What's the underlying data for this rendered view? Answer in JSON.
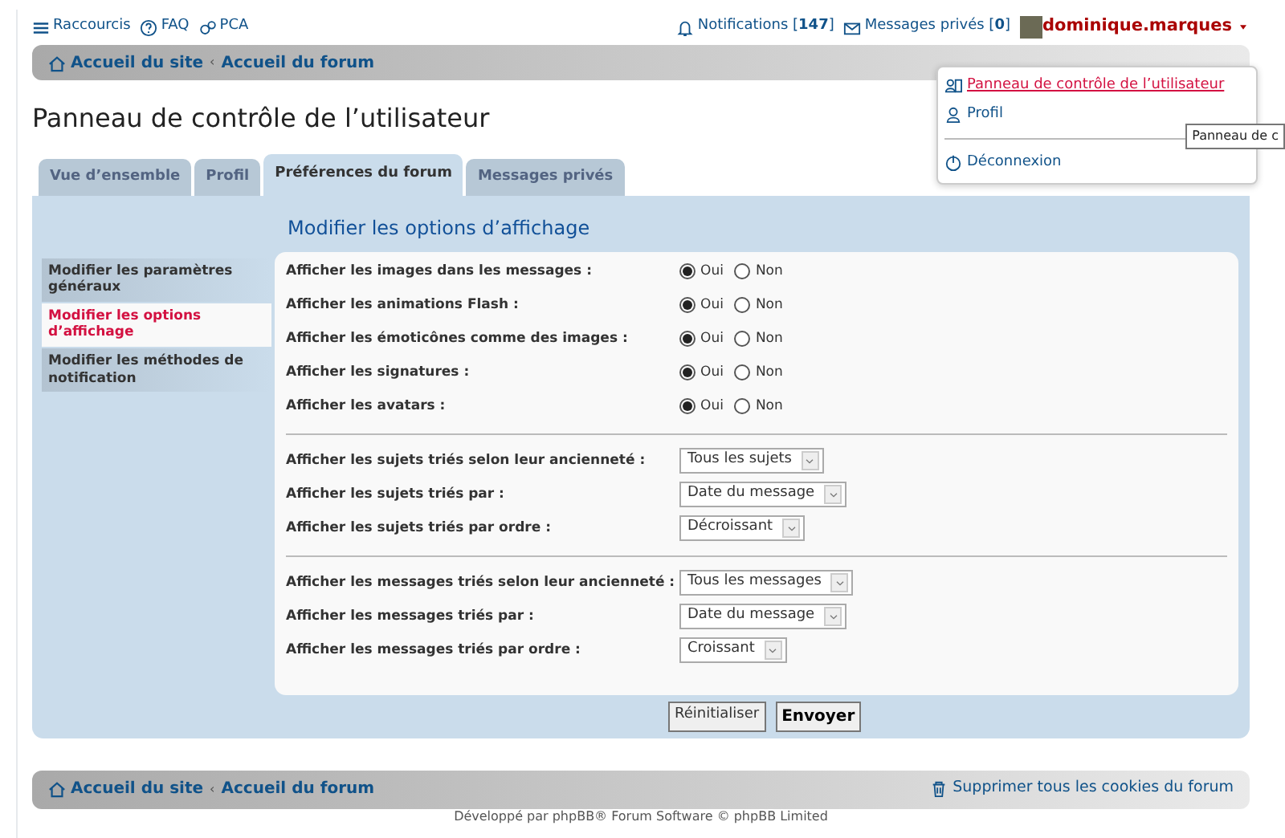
{
  "header": {
    "links": [
      {
        "label": "Raccourcis",
        "kind": "menu"
      },
      {
        "label": "FAQ",
        "kind": "faq"
      },
      {
        "label": "PCA",
        "kind": "pca"
      }
    ],
    "notifications": {
      "label": "Notifications [**147**]"
    },
    "messages": {
      "label": "Messages privés [**0**]"
    },
    "user": {
      "name": "dominique.marques",
      "expanded": true
    }
  },
  "breadcrumb": [
    "Accueil du site",
    "Accueil du forum"
  ],
  "breadcrumb_separator": "‹",
  "user_menu": [
    {
      "label": "Panneau de contrôle de l’utilisateur",
      "kind": "ucp",
      "selected": true
    },
    {
      "label": "Profil",
      "kind": "profile",
      "selected": false
    },
    {
      "label": "Déconnexion",
      "kind": "logout",
      "selected": false
    }
  ],
  "tooltip": "Panneau de c",
  "title": "Panneau de contrôle de l’utilisateur",
  "tabs": [
    {
      "label": "Vue d’ensemble",
      "selected": false
    },
    {
      "label": "Profil",
      "selected": false
    },
    {
      "label": "Préférences du forum",
      "selected": true
    },
    {
      "label": "Messages privés",
      "selected": false
    }
  ],
  "sidebar": [
    {
      "label": "Modifier les paramètres généraux",
      "selected": false
    },
    {
      "label": "Modifier les options d’affichage",
      "selected": true
    },
    {
      "label": "Modifier les méthodes de notification",
      "selected": false
    }
  ],
  "section_title": "Modifier les options d’affichage",
  "groups": [
    [
      {
        "label": "Afficher les images dans les messages :",
        "kind": "radio",
        "options": [
          {
            "label": "Oui",
            "selected": true
          },
          {
            "label": "Non",
            "selected": false
          }
        ]
      },
      {
        "label": "Afficher les animations Flash :",
        "kind": "radio",
        "options": [
          {
            "label": "Oui",
            "selected": true
          },
          {
            "label": "Non",
            "selected": false
          }
        ]
      },
      {
        "label": "Afficher les émoticônes comme des images :",
        "kind": "radio",
        "options": [
          {
            "label": "Oui",
            "selected": true
          },
          {
            "label": "Non",
            "selected": false
          }
        ]
      },
      {
        "label": "Afficher les signatures :",
        "kind": "radio",
        "options": [
          {
            "label": "Oui",
            "selected": true
          },
          {
            "label": "Non",
            "selected": false
          }
        ]
      },
      {
        "label": "Afficher les avatars :",
        "kind": "radio",
        "options": [
          {
            "label": "Oui",
            "selected": true
          },
          {
            "label": "Non",
            "selected": false
          }
        ]
      }
    ],
    [
      {
        "label": "Afficher les sujets triés selon leur ancienneté :",
        "kind": "select",
        "value": "Tous les sujets"
      },
      {
        "label": "Afficher les sujets triés par :",
        "kind": "select",
        "value": "Date du message"
      },
      {
        "label": "Afficher les sujets triés par ordre :",
        "kind": "select",
        "value": "Décroissant"
      }
    ],
    [
      {
        "label": "Afficher les messages triés selon leur ancienneté :",
        "kind": "select",
        "value": "Tous les messages"
      },
      {
        "label": "Afficher les messages triés par :",
        "kind": "select",
        "value": "Date du message"
      },
      {
        "label": "Afficher les messages triés par ordre :",
        "kind": "select",
        "value": "Croissant"
      }
    ]
  ],
  "buttons": [
    {
      "label": "Réinitialiser",
      "kind": "reset"
    },
    {
      "label": "Envoyer",
      "kind": "submit"
    }
  ],
  "footer": {
    "breadcrumb": [
      "Accueil du site",
      "Accueil du forum"
    ],
    "breadcrumb_separator": "‹",
    "cookies": "Supprimer tous les cookies du forum",
    "copyright": "Développé par phpBB® Forum Software © phpBB Limited"
  }
}
